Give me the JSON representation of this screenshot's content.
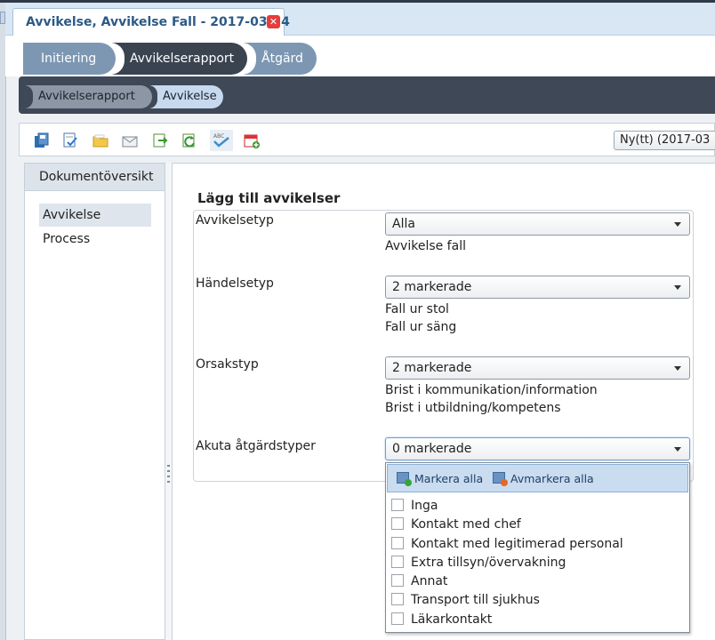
{
  "document": {
    "tab_title": "Avvikelse, Avvikelse Fall - 2017-03-24",
    "close_symbol": "✕"
  },
  "steps": [
    "Initiering",
    "Avvikelserapport",
    "Åtgärd"
  ],
  "substeps": [
    "Avvikelserapport",
    "Avvikelse"
  ],
  "toolbar": {
    "icons": [
      "save-icon",
      "edit-check-icon",
      "folder-icon",
      "mail-icon",
      "export-icon",
      "refresh-icon",
      "spellcheck-icon",
      "calendar-add-icon"
    ],
    "status_select": "Ny(tt)  (2017-03"
  },
  "sidebar": {
    "title": "Dokumentöversikt",
    "items": [
      "Avvikelse",
      "Process"
    ]
  },
  "form": {
    "title": "Lägg till avvikelser",
    "fields": [
      {
        "label": "Avvikelsetyp",
        "value": "Alla",
        "selected": [
          "Avvikelse fall"
        ]
      },
      {
        "label": "Händelsetyp",
        "value": "2 markerade",
        "selected": [
          "Fall ur stol",
          "Fall ur säng"
        ]
      },
      {
        "label": "Orsakstyp",
        "value": "2 markerade",
        "selected": [
          "Brist i kommunikation/information",
          "Brist i utbildning/kompetens"
        ]
      },
      {
        "label": "Akuta åtgärdstyper",
        "value": "0 markerade",
        "selected": []
      }
    ]
  },
  "popup": {
    "select_all": "Markera alla",
    "deselect_all": "Avmarkera alla",
    "options": [
      "Inga",
      "Kontakt med chef",
      "Kontakt med legitimerad personal",
      "Extra tillsyn/övervakning",
      "Annat",
      "Transport till sjukhus",
      "Läkarkontakt"
    ]
  },
  "colors": {
    "accent": "#2b5a86",
    "step_active": "#3a4350",
    "step_inactive": "#7d97b3"
  }
}
